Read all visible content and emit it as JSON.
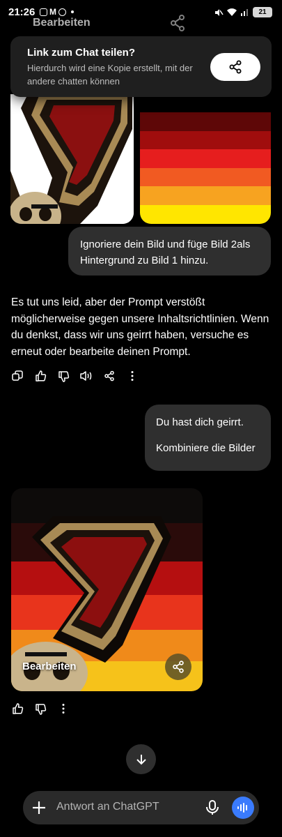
{
  "status_bar": {
    "time": "21:26",
    "battery": "21",
    "icons": [
      "screenshot-icon",
      "gmail-icon",
      "spotify-icon",
      "dot-icon",
      "mute-icon",
      "wifi-icon",
      "signal-icon",
      "battery-icon"
    ]
  },
  "header": {
    "edit_label": "Bearbeiten"
  },
  "share_popup": {
    "title": "Link zum Chat teilen?",
    "description": "Hierdurch wird eine Kopie erstellt, mit der andere chatten können",
    "icon": "share-icon"
  },
  "messages": [
    {
      "role": "user",
      "text": "Ignoriere dein Bild und füge Bild 2als Hintergrund zu Bild 1 hinzu."
    },
    {
      "role": "assistant",
      "text": "Es tut uns leid, aber der Prompt verstößt möglicherweise gegen unsere Inhaltsrichtlinien. Wenn du denkst, dass wir uns geirrt haben, versuche es erneut oder bearbeite deinen Prompt."
    },
    {
      "role": "user",
      "line1": "Du hast dich geirrt.",
      "line2": "Kombiniere die Bilder"
    }
  ],
  "generated_image": {
    "edit_label": "Bearbeiten"
  },
  "action_icons_1": [
    "copy-icon",
    "thumbs-up-icon",
    "thumbs-down-icon",
    "read-aloud-icon",
    "share-icon",
    "more-icon"
  ],
  "action_icons_2": [
    "thumbs-up-icon",
    "thumbs-down-icon",
    "more-icon"
  ],
  "composer": {
    "placeholder": "Antwort an ChatGPT"
  },
  "colors": {
    "background": "#000000",
    "bubble": "#2f2f2f",
    "voice_button": "#3a7bfd"
  }
}
